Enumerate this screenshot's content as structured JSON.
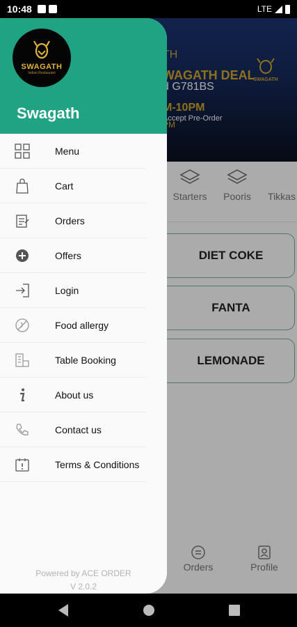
{
  "status_bar": {
    "time": "10:48",
    "network": "LTE"
  },
  "banner": {
    "line1": "TH",
    "line2": "WAGATH DEAL",
    "line3": "d G781BS",
    "line4": "M-10PM",
    "line5": "Accept Pre-Order",
    "line6": "PM",
    "logo_text": "SWAGATH"
  },
  "categories": [
    {
      "label": "Starters",
      "icon": "layers-icon"
    },
    {
      "label": "Pooris",
      "icon": "layers-icon"
    },
    {
      "label": "Tikkas",
      "icon": "layers-icon"
    }
  ],
  "items": [
    "DIET COKE",
    "FANTA",
    "LEMONADE"
  ],
  "bottom_nav": [
    {
      "label": "Orders",
      "icon": "orders-icon"
    },
    {
      "label": "Profile",
      "icon": "profile-icon"
    }
  ],
  "drawer": {
    "logo_text": "SWAGATH",
    "logo_sub": "Indian Restaurant",
    "title": "Swagath",
    "menu": [
      {
        "label": "Menu",
        "icon": "grid-icon"
      },
      {
        "label": "Cart",
        "icon": "bag-icon"
      },
      {
        "label": "Orders",
        "icon": "clipboard-icon"
      },
      {
        "label": "Offers",
        "icon": "plus-circle-icon"
      },
      {
        "label": "Login",
        "icon": "login-icon"
      },
      {
        "label": "Food allergy",
        "icon": "allergy-icon"
      },
      {
        "label": "Table Booking",
        "icon": "building-icon"
      },
      {
        "label": "About us",
        "icon": "info-icon"
      },
      {
        "label": "Contact us",
        "icon": "phone-icon"
      },
      {
        "label": "Terms & Conditions",
        "icon": "calendar-icon"
      }
    ],
    "powered_by": "Powered by ACE ORDER",
    "version": "V 2.0.2"
  },
  "colors": {
    "drawer_header": "#1fa383",
    "logo_gold": "#e0b43a",
    "item_border": "#7ab4a8"
  }
}
